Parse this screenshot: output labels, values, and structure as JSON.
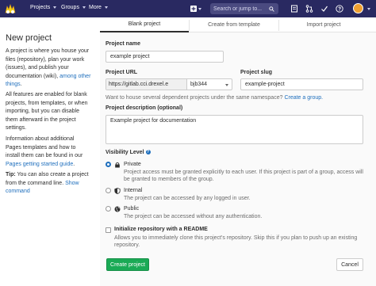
{
  "nav": {
    "projects_label": "Projects",
    "groups_label": "Groups",
    "more_label": "More",
    "search_placeholder": "Search or jump to..."
  },
  "sidebar": {
    "title": "New project",
    "intro_text": "A project is where you house your files (repository), plan your work (issues), and publish your documentation (wiki), ",
    "intro_link": "among other things",
    "intro_end": ".",
    "features_text": "All features are enabled for blank projects, from templates, or when importing, but you can disable them afterward in the project settings.",
    "pages_text": "Information about additional Pages templates and how to install them can be found in our ",
    "pages_link": "Pages getting started guide",
    "pages_end": ".",
    "tip_label": "Tip:",
    "tip_text": " You can also create a project from the command line. ",
    "tip_link": "Show command"
  },
  "tabs": [
    {
      "label": "Blank project"
    },
    {
      "label": "Create from template"
    },
    {
      "label": "Import project"
    }
  ],
  "form": {
    "name_label": "Project name",
    "name_value": "example project",
    "url_label": "Project URL",
    "url_prefix": "https://gitlab.cci.drexel.e",
    "url_namespace": "bjb344",
    "slug_label": "Project slug",
    "slug_value": "example-project",
    "namespace_hint": "Want to house several dependent projects under the same namespace? ",
    "namespace_link": "Create a group.",
    "desc_label": "Project description (optional)",
    "desc_value": "Example project for documentation",
    "visibility_label": "Visibility Level",
    "visibility": [
      {
        "name": "Private",
        "desc": "Project access must be granted explicitly to each user. If this project is part of a group, access will be granted to members of the group.",
        "selected": true,
        "icon": "lock-icon"
      },
      {
        "name": "Internal",
        "desc": "The project can be accessed by any logged in user.",
        "selected": false,
        "icon": "shield-icon"
      },
      {
        "name": "Public",
        "desc": "The project can be accessed without any authentication.",
        "selected": false,
        "icon": "globe-icon"
      }
    ],
    "readme_label": "Initialize repository with a README",
    "readme_desc": "Allows you to immediately clone this project's repository. Skip this if you plan to push up an existing repository.",
    "create_button": "Create project",
    "cancel_button": "Cancel"
  },
  "colors": {
    "navbar": "#292961",
    "primary": "#1aaa55",
    "link": "#1f6fbd"
  }
}
